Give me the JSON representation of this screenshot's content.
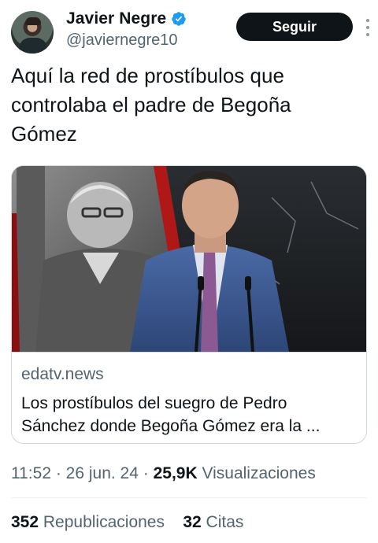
{
  "author": {
    "name": "Javier Negre",
    "handle": "@javiernegre10"
  },
  "follow_label": "Seguir",
  "tweet": {
    "text_line1": "Aquí la red de prostíbulos que",
    "text_line2": "controlaba el padre de Begoña",
    "text_line3": "Gómez"
  },
  "card": {
    "domain": "edatv.news",
    "title_line1": "Los prostíbulos del suegro de Pedro",
    "title_line2": "Sánchez donde Begoña Gómez era la ..."
  },
  "meta": {
    "time": "11:52",
    "sep1": " · ",
    "date": "26 jun. 24",
    "sep2": " · ",
    "views_count": "25,9K",
    "views_label": " Visualizaciones"
  },
  "stats": {
    "reposts_count": "352",
    "reposts_label": " Republicaciones",
    "quotes_count": "32",
    "quotes_label": " Citas"
  },
  "colors": {
    "verified": "#1d9bf0",
    "text": "#0f1419",
    "secondary": "#536471",
    "border": "#cfd9de"
  },
  "icons": [
    "verified-badge-icon",
    "more-options-icon"
  ]
}
